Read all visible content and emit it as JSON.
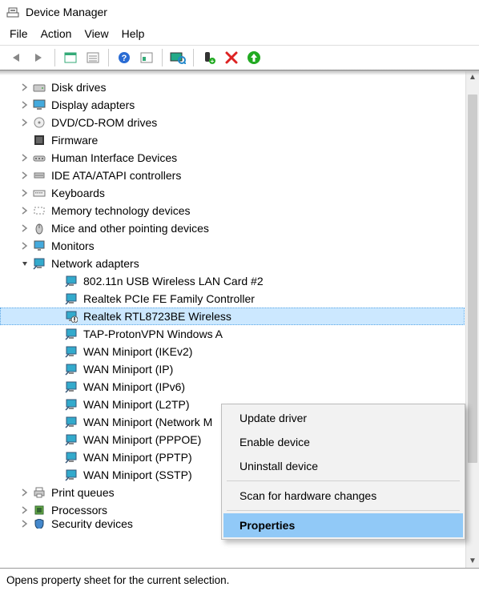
{
  "window": {
    "title": "Device Manager"
  },
  "menubar": [
    "File",
    "Action",
    "View",
    "Help"
  ],
  "toolbar": [
    {
      "name": "nav-back-button",
      "icon": "arrow-left"
    },
    {
      "name": "nav-forward-button",
      "icon": "arrow-right"
    },
    {
      "sep": true
    },
    {
      "name": "show-hidden-button",
      "icon": "window"
    },
    {
      "name": "properties-toolbar-button",
      "icon": "list"
    },
    {
      "sep": true
    },
    {
      "name": "help-button",
      "icon": "help"
    },
    {
      "name": "action-button",
      "icon": "sheet"
    },
    {
      "sep": true
    },
    {
      "name": "scan-button",
      "icon": "monitor-scan"
    },
    {
      "sep": true
    },
    {
      "name": "add-legacy-button",
      "icon": "plug-plus"
    },
    {
      "name": "remove-button",
      "icon": "x-red"
    },
    {
      "name": "enable-button",
      "icon": "circle-up"
    }
  ],
  "tree": [
    {
      "label": "Disk drives",
      "icon": "disk",
      "expand": "closed"
    },
    {
      "label": "Display adapters",
      "icon": "display",
      "expand": "closed"
    },
    {
      "label": "DVD/CD-ROM drives",
      "icon": "dvd",
      "expand": "closed"
    },
    {
      "label": "Firmware",
      "icon": "firmware",
      "expand": "none"
    },
    {
      "label": "Human Interface Devices",
      "icon": "hid",
      "expand": "closed"
    },
    {
      "label": "IDE ATA/ATAPI controllers",
      "icon": "ide",
      "expand": "closed"
    },
    {
      "label": "Keyboards",
      "icon": "keyboard",
      "expand": "closed"
    },
    {
      "label": "Memory technology devices",
      "icon": "memory",
      "expand": "closed"
    },
    {
      "label": "Mice and other pointing devices",
      "icon": "mouse",
      "expand": "closed"
    },
    {
      "label": "Monitors",
      "icon": "monitor",
      "expand": "closed"
    },
    {
      "label": "Network adapters",
      "icon": "network",
      "expand": "open",
      "children": [
        {
          "label": "802.11n USB Wireless LAN Card #2",
          "icon": "net-card"
        },
        {
          "label": "Realtek PCIe FE Family Controller",
          "icon": "net-card"
        },
        {
          "label": "Realtek RTL8723BE Wireless",
          "icon": "net-card-warn",
          "selected": true
        },
        {
          "label": "TAP-ProtonVPN Windows A",
          "icon": "net-card",
          "truncated": true
        },
        {
          "label": "WAN Miniport (IKEv2)",
          "icon": "net-card"
        },
        {
          "label": "WAN Miniport (IP)",
          "icon": "net-card"
        },
        {
          "label": "WAN Miniport (IPv6)",
          "icon": "net-card"
        },
        {
          "label": "WAN Miniport (L2TP)",
          "icon": "net-card"
        },
        {
          "label": "WAN Miniport (Network M",
          "icon": "net-card",
          "truncated": true
        },
        {
          "label": "WAN Miniport (PPPOE)",
          "icon": "net-card"
        },
        {
          "label": "WAN Miniport (PPTP)",
          "icon": "net-card"
        },
        {
          "label": "WAN Miniport (SSTP)",
          "icon": "net-card"
        }
      ]
    },
    {
      "label": "Print queues",
      "icon": "printer",
      "expand": "closed"
    },
    {
      "label": "Processors",
      "icon": "cpu",
      "expand": "closed"
    },
    {
      "label": "Security devices",
      "icon": "security",
      "expand": "closed",
      "cutoff": true
    }
  ],
  "context_menu": {
    "items": [
      {
        "label": "Update driver"
      },
      {
        "label": "Enable device"
      },
      {
        "label": "Uninstall device"
      },
      {
        "sep": true
      },
      {
        "label": "Scan for hardware changes"
      },
      {
        "sep": true
      },
      {
        "label": "Properties",
        "highlight": true
      }
    ]
  },
  "status": "Opens property sheet for the current selection."
}
